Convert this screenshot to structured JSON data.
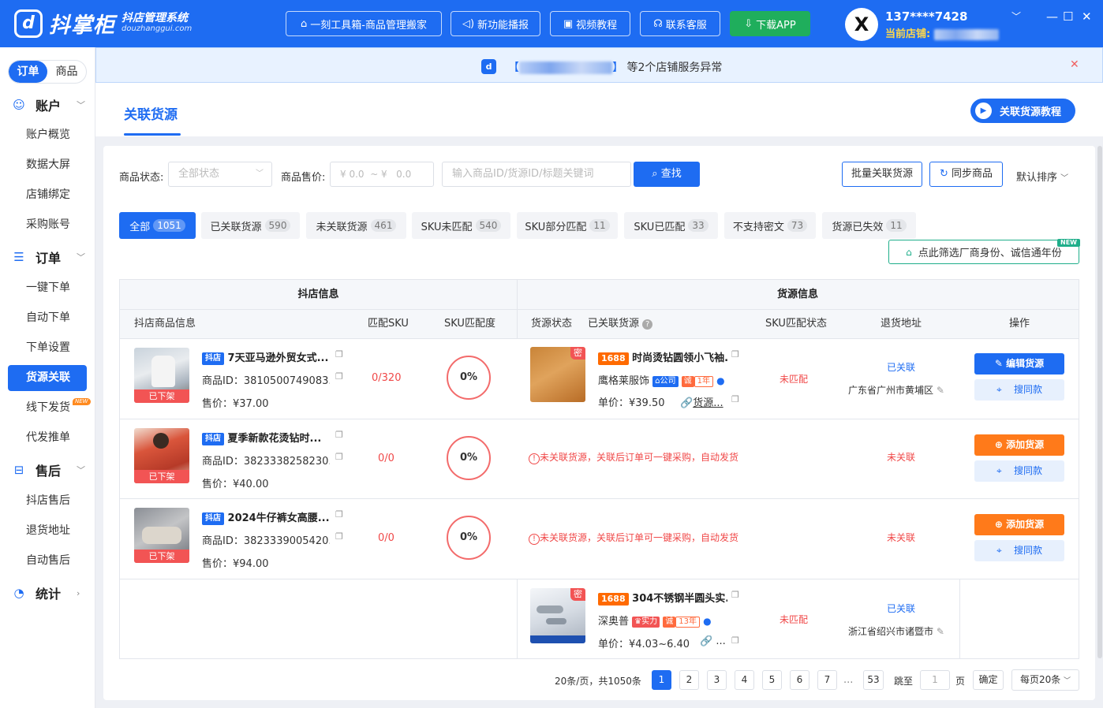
{
  "header": {
    "logo_mark": "d",
    "logo_text": "抖掌柜",
    "logo_subtitle": "抖店管理系统",
    "logo_domain": "douzhanggui.com",
    "buttons": [
      {
        "label": "一刻工具箱-商品管理搬家",
        "icon": "toolbox-icon"
      },
      {
        "label": "新功能播报",
        "icon": "megaphone-icon"
      },
      {
        "label": "视频教程",
        "icon": "video-icon"
      },
      {
        "label": "联系客服",
        "icon": "headset-icon"
      },
      {
        "label": "下载APP",
        "icon": "download-icon"
      }
    ],
    "avatar": "X",
    "user_name": "137****7428",
    "current_shop_label": "当前店铺:",
    "window": {
      "minimize": "—",
      "maximize": "☐",
      "close": "✕"
    }
  },
  "sidebar": {
    "segments": [
      "订单",
      "商品"
    ],
    "groups": [
      {
        "label": "账户",
        "items": [
          "账户概览",
          "数据大屏",
          "店铺绑定",
          "采购账号"
        ]
      },
      {
        "label": "订单",
        "items": [
          "一键下单",
          "自动下单",
          "下单设置",
          "货源关联",
          "线下发货",
          "代发推单"
        ]
      },
      {
        "label": "售后",
        "items": [
          "抖店售后",
          "退货地址",
          "自动售后"
        ]
      },
      {
        "label": "统计",
        "items": []
      }
    ],
    "new_tag": "NEW"
  },
  "notice": {
    "bracket_left": "【",
    "bracket_right": "】",
    "text": "等2个店铺服务异常"
  },
  "page": {
    "title": "关联货源",
    "tutorial_button": "关联货源教程"
  },
  "filters": {
    "status_label": "商品状态:",
    "status_value": "全部状态",
    "price_label": "商品售价:",
    "price_min": "¥  0.0",
    "price_sep": "~ ¥",
    "price_max": "0.0",
    "search_placeholder": "输入商品ID/货源ID/标题关键词",
    "search_button": "查找",
    "batch_button": "批量关联货源",
    "sync_button": "同步商品",
    "sort_label": "默认排序"
  },
  "tabs": [
    {
      "label": "全部",
      "count": "1051"
    },
    {
      "label": "已关联货源",
      "count": "590"
    },
    {
      "label": "未关联货源",
      "count": "461"
    },
    {
      "label": "SKU未匹配",
      "count": "540"
    },
    {
      "label": "SKU部分匹配",
      "count": "11"
    },
    {
      "label": "SKU已匹配",
      "count": "33"
    },
    {
      "label": "不支持密文",
      "count": "73"
    },
    {
      "label": "货源已失效",
      "count": "11"
    }
  ],
  "filter_hint": {
    "label": "点此筛选厂商身份、诚信通年份",
    "badge": "NEW"
  },
  "table": {
    "group_headers": [
      "抖店信息",
      "货源信息"
    ],
    "columns": [
      "抖店商品信息",
      "匹配SKU",
      "SKU匹配度",
      "货源状态",
      "已关联货源",
      "SKU匹配状态",
      "退货地址",
      "操作"
    ],
    "rows": [
      {
        "store_tag": "抖店",
        "title": "7天亚马逊外贸女式...",
        "product_id": "商品ID：3810500749083...",
        "price": "售价：¥37.00",
        "shelf": "已下架",
        "match_sku": "0/320",
        "match_rate": "0%",
        "source": {
          "secret_tag": "密",
          "tag": "1688",
          "title": "时尚烫钻圆领小飞袖...",
          "shop": "鹰格莱服饰",
          "badges": [
            "公司",
            "诚",
            "1年"
          ],
          "unit_price": "单价：¥39.50",
          "link": "货源...",
          "sku_status": "未匹配",
          "relation": "已关联",
          "return_address": "广东省广州市黄埔区"
        },
        "primary_action": "编辑货源",
        "secondary_action": "搜同款"
      },
      {
        "store_tag": "抖店",
        "title": "夏季新款花烫钻时...",
        "product_id": "商品ID：3823338258230...",
        "price": "售价：¥40.00",
        "shelf": "已下架",
        "match_sku": "0/0",
        "match_rate": "0%",
        "unlinked_message": "未关联货源，关联后订单可一键采购，自动发货",
        "relation": "未关联",
        "primary_action": "添加货源",
        "secondary_action": "搜同款"
      },
      {
        "store_tag": "抖店",
        "title": "2024牛仔裤女高腰...",
        "product_id": "商品ID：3823339005420...",
        "price": "售价：¥94.00",
        "shelf": "已下架",
        "match_sku": "0/0",
        "match_rate": "0%",
        "unlinked_message": "未关联货源，关联后订单可一键采购，自动发货",
        "relation": "未关联",
        "primary_action": "添加货源",
        "secondary_action": "搜同款"
      },
      {
        "source": {
          "secret_tag": "密",
          "tag": "1688",
          "title": "304不锈钢半圆头实...",
          "shop": "深奥普",
          "badges": [
            "实力",
            "诚",
            "13年"
          ],
          "unit_price": "单价：¥4.03~6.40",
          "link": "...",
          "sku_status": "未匹配",
          "relation": "已关联",
          "return_address": "浙江省绍兴市诸暨市"
        }
      }
    ]
  },
  "pagination": {
    "summary": "20条/页，共1050条",
    "pages": [
      "1",
      "2",
      "3",
      "4",
      "5",
      "6",
      "7"
    ],
    "ellipsis": "...",
    "last": "53",
    "goto_label": "跳至",
    "goto_value": "1",
    "page_unit": "页",
    "confirm": "确定",
    "page_size": "每页20条"
  },
  "colors": {
    "primary": "#1e6cf2",
    "danger": "#f04848",
    "warning": "#ff7a1a",
    "success": "#1fae5c"
  }
}
